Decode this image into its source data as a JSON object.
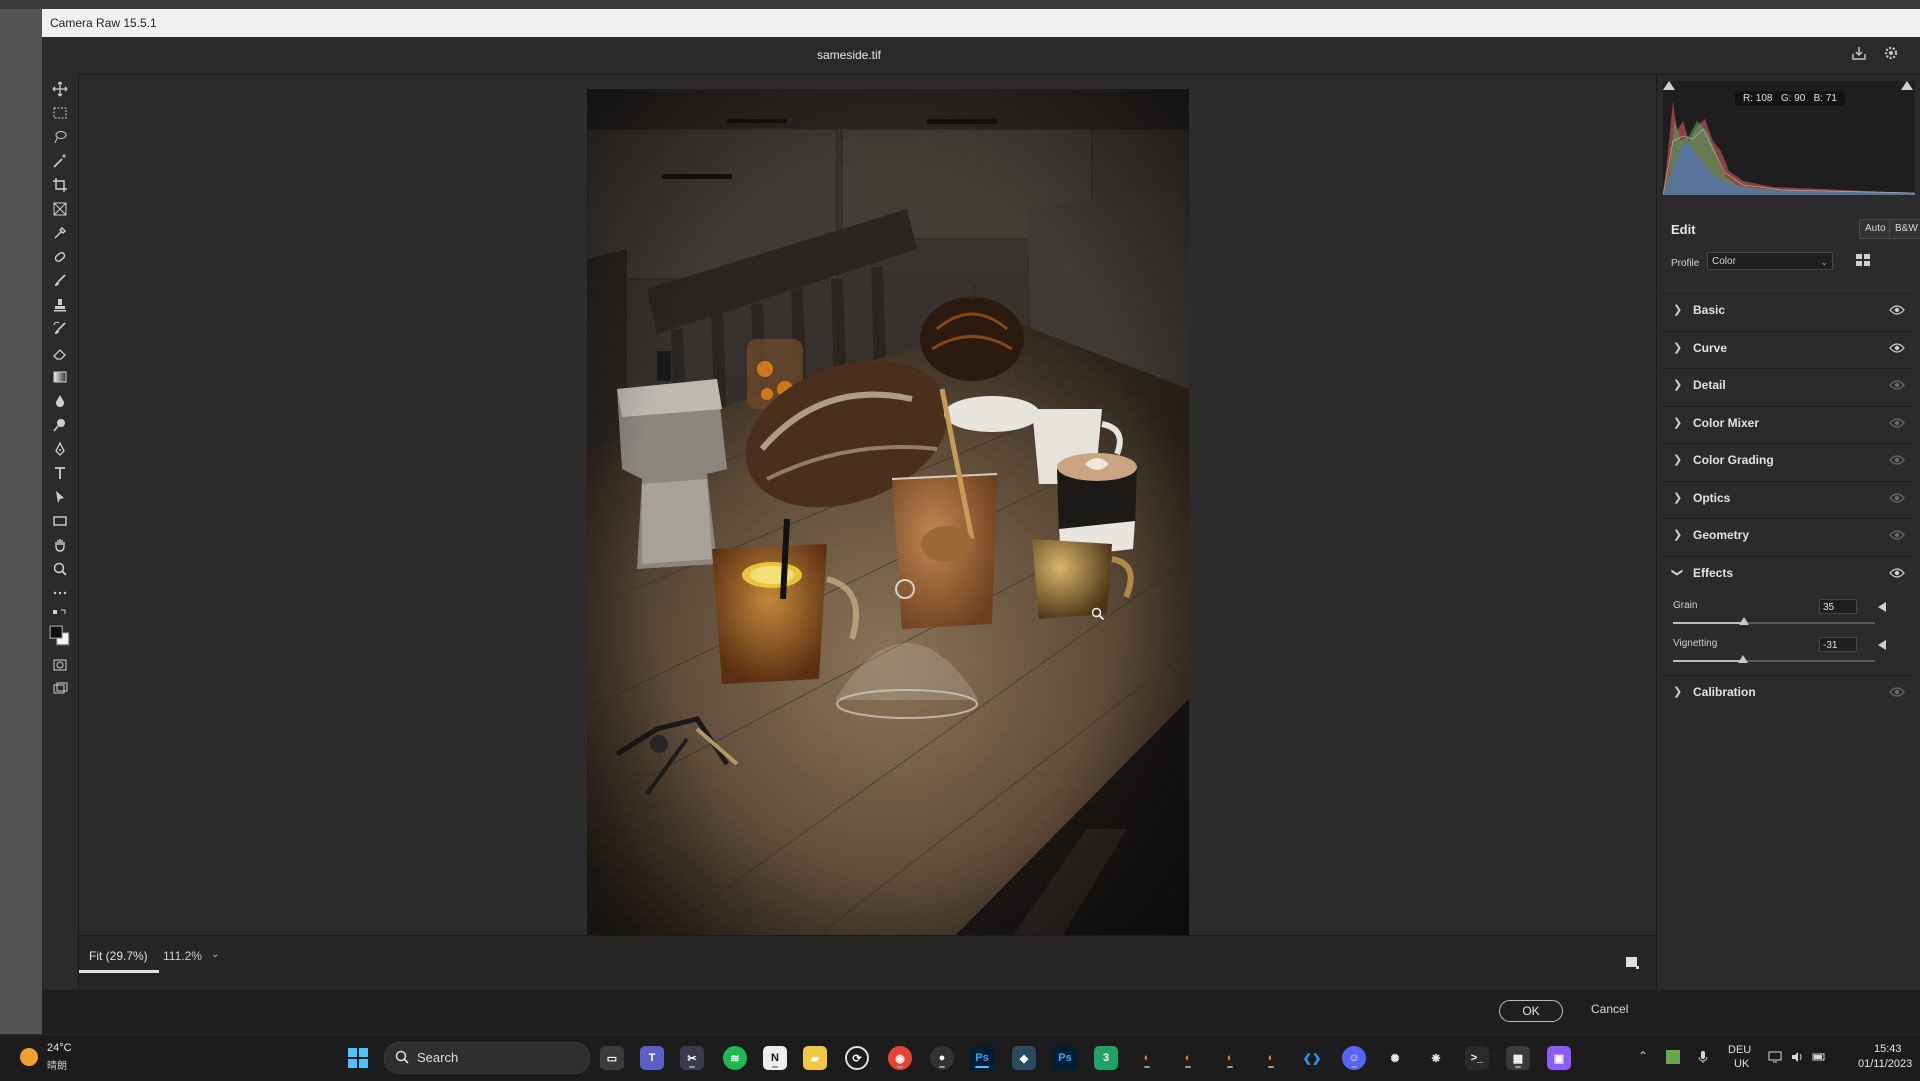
{
  "window": {
    "title": "Camera Raw 15.5.1"
  },
  "document": {
    "filename": "sameside.tif"
  },
  "histogram": {
    "r_label": "R: 108",
    "g_label": "G: 90",
    "b_label": "B: 71"
  },
  "edit": {
    "title": "Edit",
    "auto_label": "Auto",
    "bw_label": "B&W",
    "profile_label": "Profile",
    "profile_value": "Color"
  },
  "sections": {
    "basic": "Basic",
    "curve": "Curve",
    "detail": "Detail",
    "color_mixer": "Color Mixer",
    "color_grading": "Color Grading",
    "optics": "Optics",
    "geometry": "Geometry",
    "effects": "Effects",
    "calibration": "Calibration"
  },
  "effects": {
    "grain": {
      "label": "Grain",
      "value": "35",
      "level": 0.35,
      "min": 0,
      "max": 100
    },
    "vignetting": {
      "label": "Vignetting",
      "value": "-31",
      "level": -31,
      "min": -100,
      "max": 100
    }
  },
  "zoom": {
    "fit_label": "Fit (29.7%)",
    "percent": "111.2%"
  },
  "dialog": {
    "ok_label": "OK",
    "cancel_label": "Cancel"
  },
  "taskbar": {
    "weather_temp": "24°C",
    "weather_desc": "晴朗",
    "search_placeholder": "Search",
    "lang_top": "DEU",
    "lang_bottom": "UK",
    "time": "15:43",
    "date": "01/11/2023"
  },
  "colors": {
    "accent": "#e0e0e0",
    "panel": "#2b2b2b",
    "canvas": "#2c2c2c",
    "titlebar": "#f0f0f0"
  }
}
